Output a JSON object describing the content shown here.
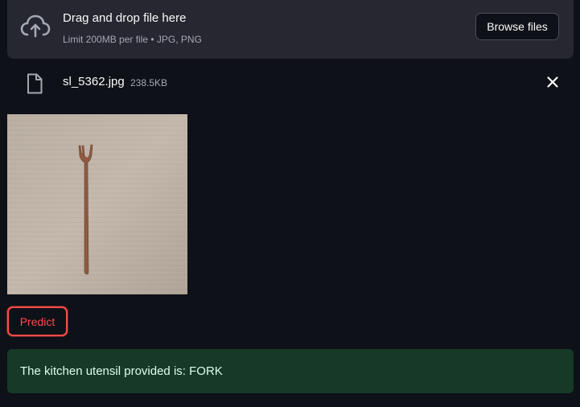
{
  "uploader": {
    "title": "Drag and drop file here",
    "limit": "Limit 200MB per file • JPG, PNG",
    "browse_label": "Browse files",
    "icon": "cloud-upload-icon"
  },
  "file": {
    "name": "sl_5362.jpg",
    "size": "238.5KB",
    "icon": "file-icon",
    "remove_icon": "close-icon"
  },
  "preview": {
    "icon": "uploaded-image"
  },
  "actions": {
    "predict_label": "Predict"
  },
  "result": {
    "message": "The kitchen utensil provided is: FORK"
  },
  "colors": {
    "background": "#0e1117",
    "panel": "#262730",
    "accent": "#ff4b4b",
    "success_bg": "#173928",
    "success_text": "#dffde9",
    "muted_text": "#a3a8b4"
  }
}
